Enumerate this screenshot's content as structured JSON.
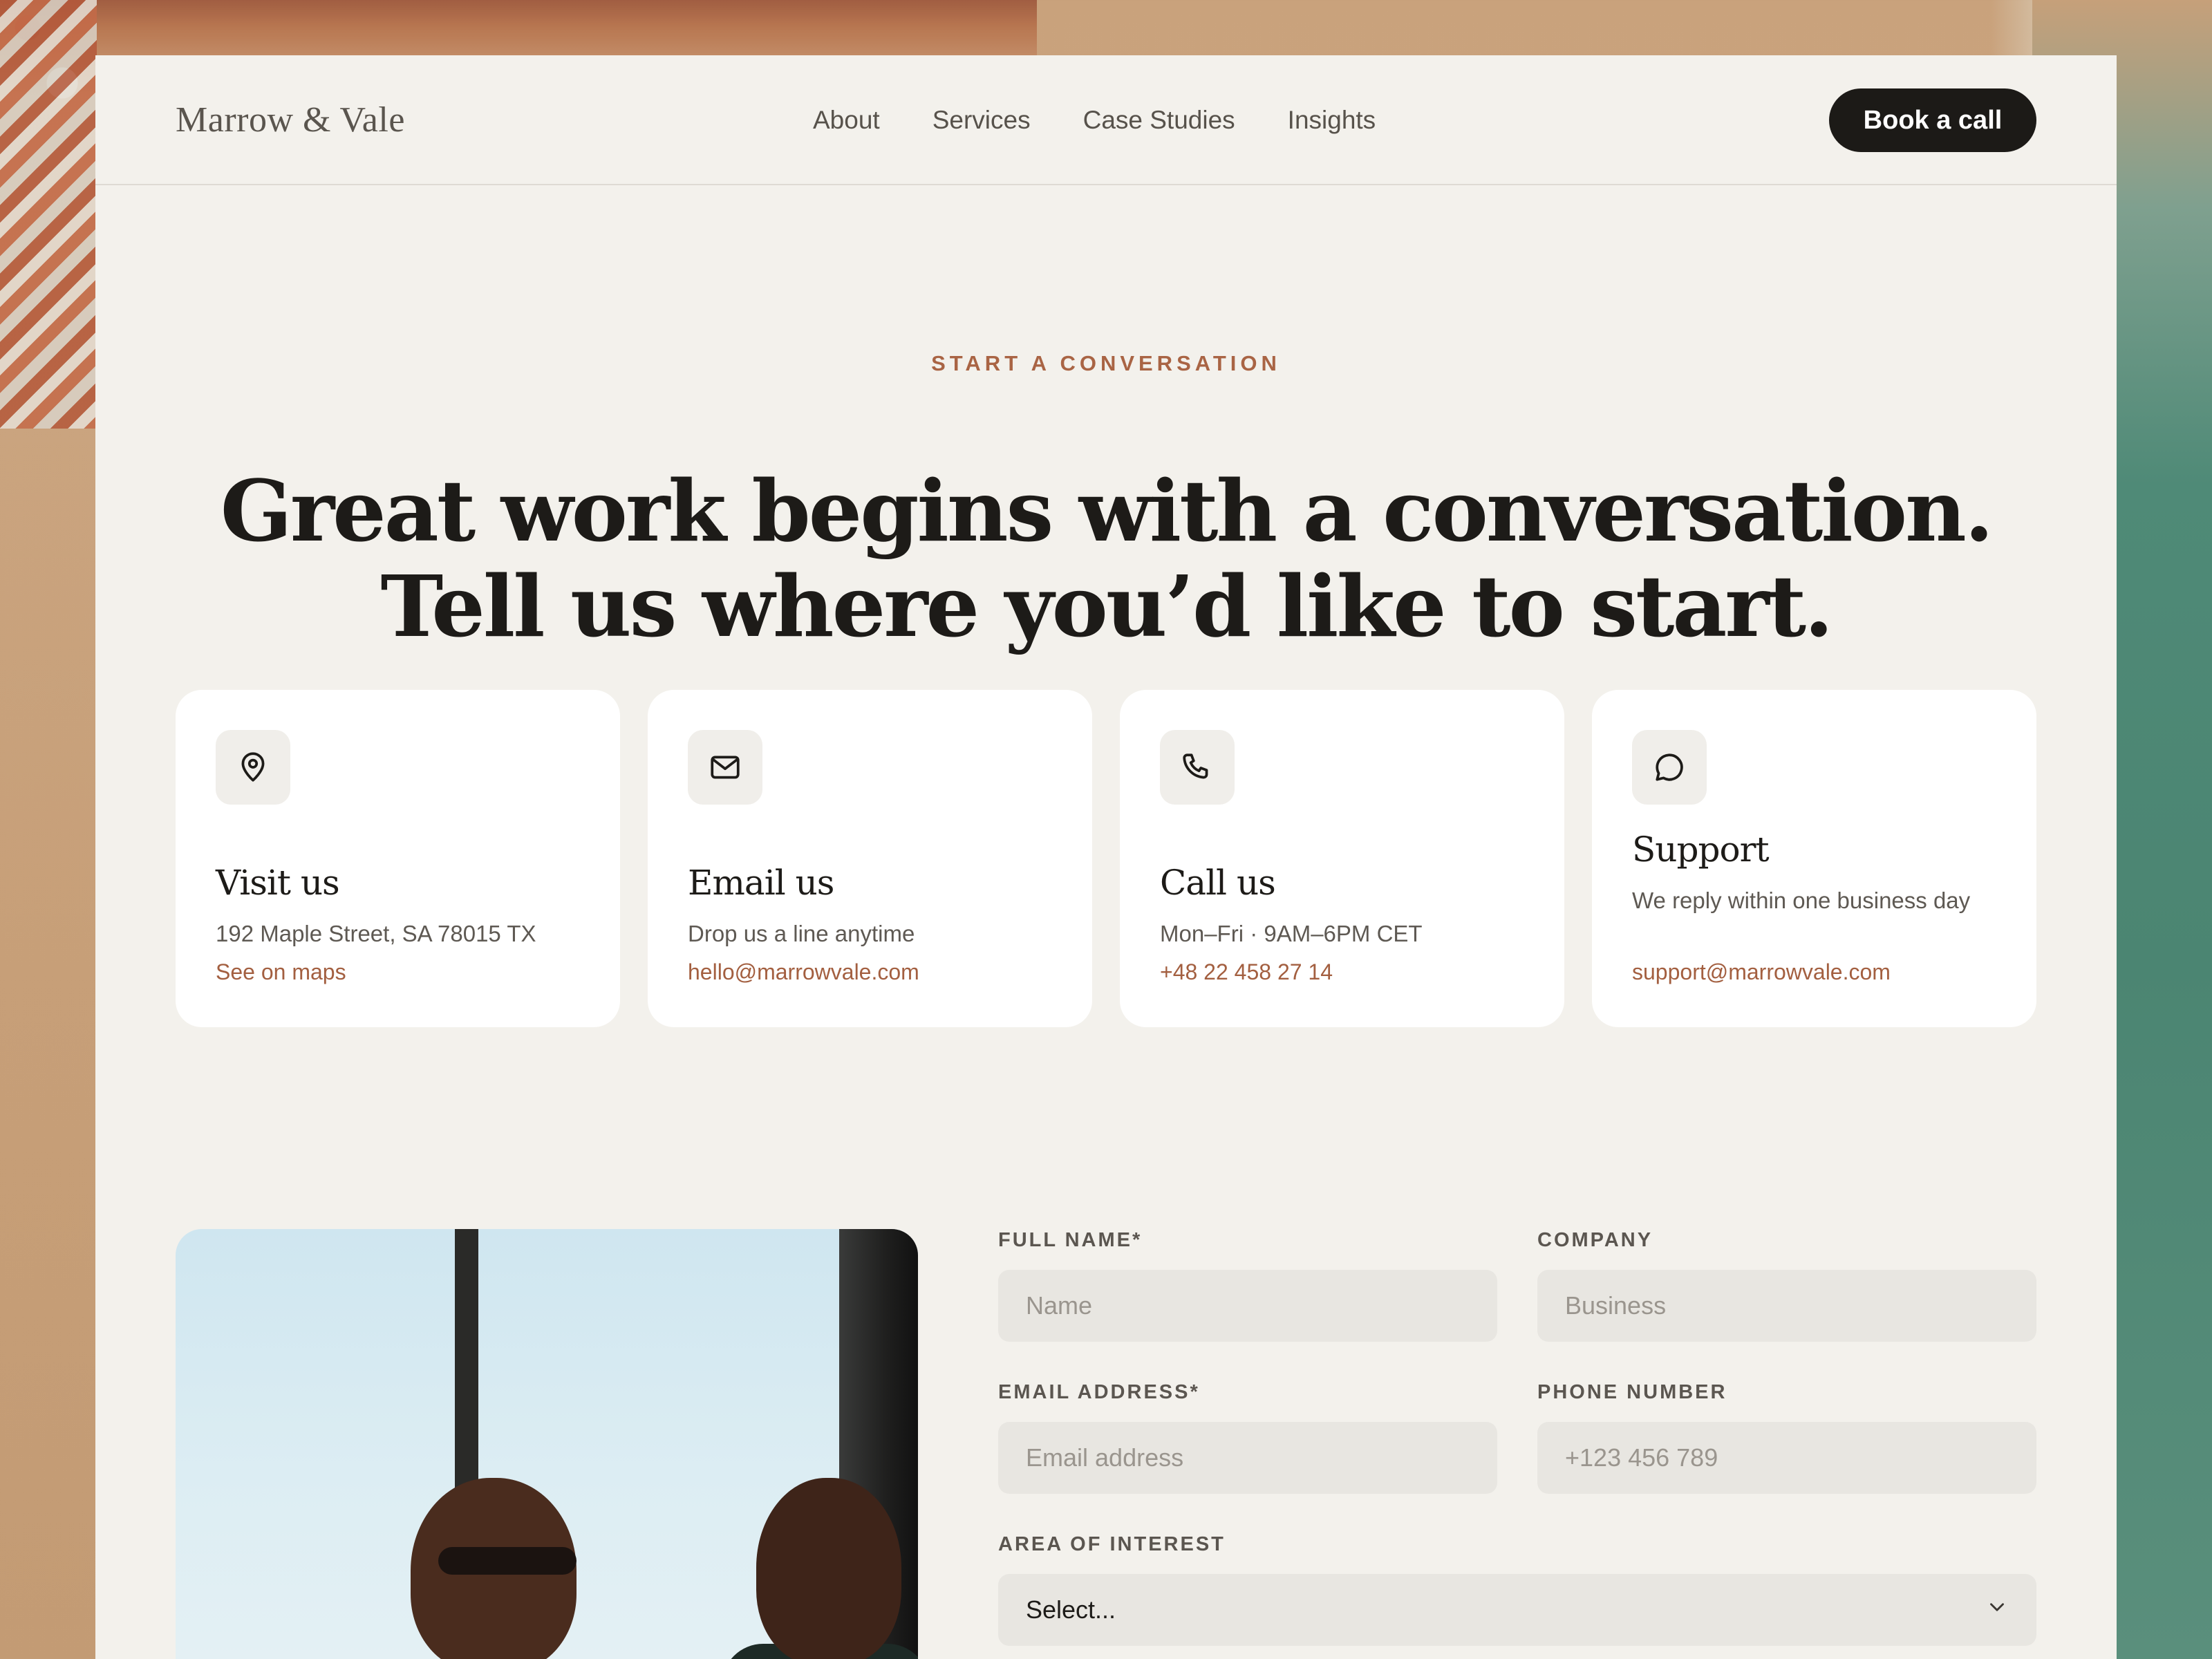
{
  "brand": {
    "name": "Marrow & Vale"
  },
  "nav": {
    "links": [
      "About",
      "Services",
      "Case Studies",
      "Insights"
    ],
    "cta": "Book a call"
  },
  "hero": {
    "eyebrow": "START A CONVERSATION",
    "line1": "Great work begins with a conversation.",
    "line2": "Tell us where you’d like to start."
  },
  "cards": [
    {
      "icon": "map-pin-icon",
      "title": "Visit us",
      "desc": "192 Maple Street, SA 78015 TX",
      "link": "See on maps"
    },
    {
      "icon": "mail-icon",
      "title": "Email us",
      "desc": "Drop us a line anytime",
      "link": "hello@marrowvale.com"
    },
    {
      "icon": "phone-icon",
      "title": "Call us",
      "desc": "Mon–Fri · 9AM–6PM CET",
      "link": "+48 22 458 27 14"
    },
    {
      "icon": "chat-bubble-icon",
      "title": "Support",
      "desc": "We reply within one business day",
      "link": "support@marrowvale.com"
    }
  ],
  "form": {
    "full_name": {
      "label": "FULL NAME*",
      "placeholder": "Name"
    },
    "company": {
      "label": "COMPANY",
      "placeholder": "Business"
    },
    "email": {
      "label": "EMAIL ADDRESS*",
      "placeholder": "Email address"
    },
    "phone": {
      "label": "PHONE NUMBER",
      "placeholder": "+123 456 789"
    },
    "area": {
      "label": "AREA OF INTEREST",
      "value": "Select..."
    }
  },
  "colors": {
    "accent": "#a96444",
    "dark": "#1c1a17",
    "sheet": "#f3f1ec"
  }
}
